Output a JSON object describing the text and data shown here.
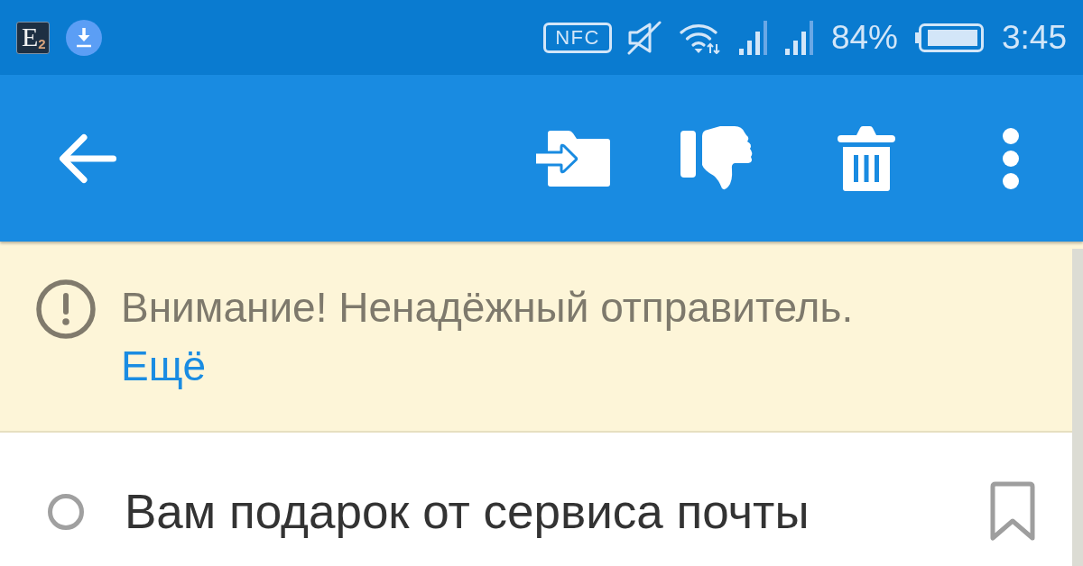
{
  "status_bar": {
    "notifications": [
      {
        "kind": "app",
        "text": "E$_{2}$"
      },
      {
        "kind": "download"
      }
    ],
    "nfc": "NFC",
    "battery": "84%",
    "time": "3:45"
  },
  "warning_banner": {
    "message": "Внимание! Ненадёжный отправитель.",
    "link": "Ещё"
  },
  "messages": [
    {
      "subject": "Вам подарок от сервиса почты",
      "unread": false,
      "flagged": false
    }
  ]
}
